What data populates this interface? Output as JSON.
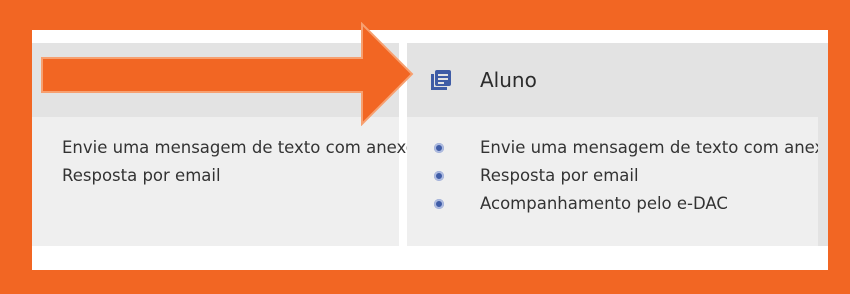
{
  "card_left": {
    "items": [
      "Envie uma mensagem de texto com anexo",
      "Resposta por email"
    ]
  },
  "card_right": {
    "title": "Aluno",
    "icon": "document-list-icon",
    "items": [
      "Envie uma mensagem de texto com anexo",
      "Resposta por email",
      "Acompanhamento pelo e-DAC"
    ]
  },
  "colors": {
    "highlight_frame": "#f26623",
    "accent": "#3f5ca6"
  }
}
